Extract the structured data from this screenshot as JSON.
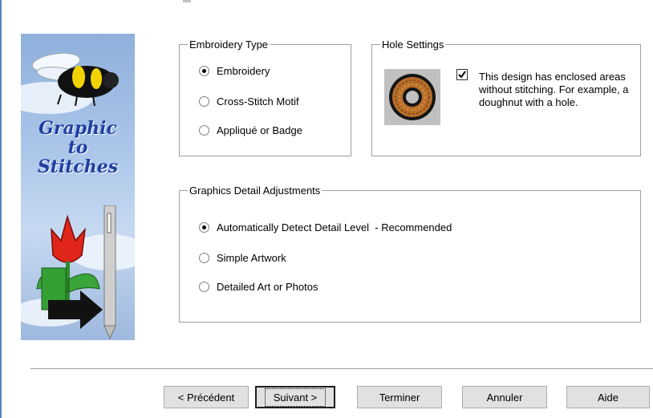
{
  "wizard_image": {
    "title_lines": [
      "Graphic",
      "to",
      "Stitches"
    ]
  },
  "embroidery_type": {
    "legend": "Embroidery Type",
    "options": [
      {
        "label": "Embroidery",
        "selected": true
      },
      {
        "label": "Cross-Stitch Motif",
        "selected": false
      },
      {
        "label": "Appliqué or Badge",
        "selected": false
      }
    ]
  },
  "hole_settings": {
    "legend": "Hole Settings",
    "checkbox_checked": true,
    "description": "This design has enclosed areas without stitching. For example, a doughnut with a hole."
  },
  "detail_adjustments": {
    "legend": "Graphics Detail Adjustments",
    "options": [
      {
        "label": "Automatically Detect Detail Level  - Recommended",
        "selected": true
      },
      {
        "label": "Simple Artwork",
        "selected": false
      },
      {
        "label": "Detailed Art or Photos",
        "selected": false
      }
    ]
  },
  "buttons": {
    "back": "< Précédent",
    "next": "Suivant >",
    "finish": "Terminer",
    "cancel": "Annuler",
    "help": "Aide"
  }
}
